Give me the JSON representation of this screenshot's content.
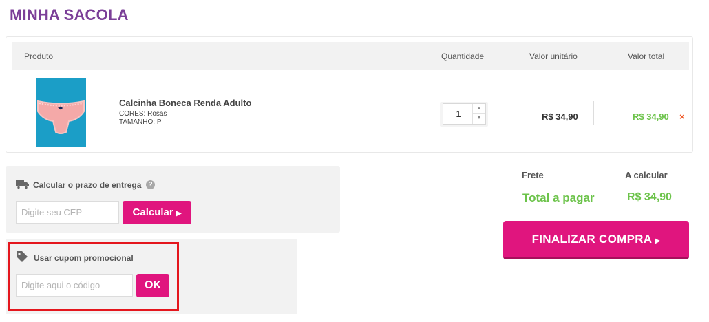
{
  "page": {
    "title": "MINHA SACOLA"
  },
  "cart": {
    "headers": {
      "product": "Produto",
      "quantity": "Quantidade",
      "unit_price": "Valor unitário",
      "total": "Valor total"
    },
    "items": [
      {
        "name": "Calcinha Boneca Renda Adulto",
        "attr_color": "CORES: Rosas",
        "attr_size": "TAMANHO: P",
        "quantity": "1",
        "unit_price": "R$ 34,90",
        "total": "R$ 34,90",
        "remove_glyph": "×"
      }
    ]
  },
  "shipping": {
    "label": "Calcular o prazo de entrega",
    "help_glyph": "?",
    "cep_placeholder": "Digite seu CEP",
    "button_label": "Calcular"
  },
  "coupon": {
    "label": "Usar cupom promocional",
    "code_placeholder": "Digite aqui o código",
    "button_label": "OK"
  },
  "summary": {
    "frete_label": "Frete",
    "frete_value": "A calcular",
    "total_label": "Total a pagar",
    "total_value": "R$ 34,90"
  },
  "checkout": {
    "button_label": "FINALIZAR COMPRA"
  },
  "icons": {
    "truck": "truck-icon",
    "tag": "tag-icon",
    "help": "help-icon",
    "remove": "close-icon",
    "arrow": "caret-right-icon"
  },
  "colors": {
    "title": "#7b3f98",
    "accent": "#e0157e",
    "price_green": "#6cc34a",
    "remove": "#f05a28",
    "highlight": "#e4161d"
  }
}
